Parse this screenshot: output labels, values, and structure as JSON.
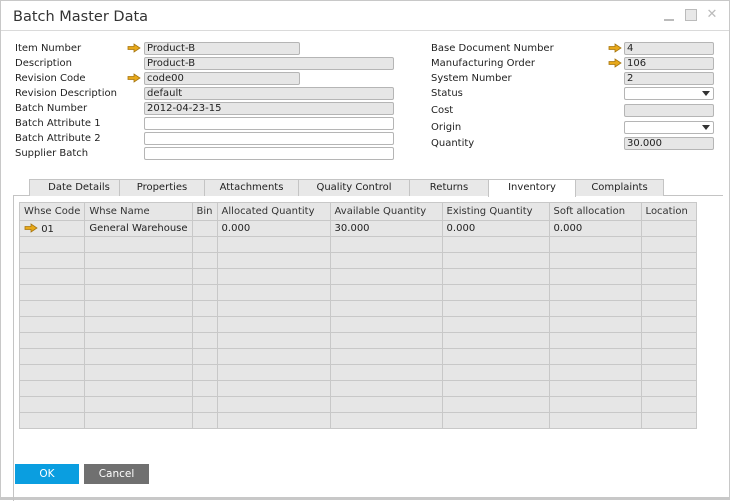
{
  "window": {
    "title": "Batch Master Data",
    "controls": [
      "minimize",
      "maximize",
      "close"
    ]
  },
  "left_fields": [
    {
      "label": "Item Number",
      "value": "Product-B",
      "link_arrow": true
    },
    {
      "label": "Description",
      "value": "Product-B",
      "link_arrow": false
    },
    {
      "label": "Revision Code",
      "value": "code00",
      "link_arrow": true
    },
    {
      "label": "Revision Description",
      "value": "default",
      "link_arrow": false
    },
    {
      "label": "Batch Number",
      "value": "2012-04-23-15",
      "link_arrow": false
    },
    {
      "label": "Batch Attribute 1",
      "value": "",
      "link_arrow": false
    },
    {
      "label": "Batch Attribute 2",
      "value": "",
      "link_arrow": false
    },
    {
      "label": "Supplier Batch",
      "value": "",
      "link_arrow": false
    }
  ],
  "right_fields": [
    {
      "label": "Base Document Number",
      "value": "4",
      "link_arrow": true
    },
    {
      "label": "Manufacturing Order",
      "value": "106",
      "link_arrow": true
    },
    {
      "label": "System Number",
      "value": "2",
      "link_arrow": false
    },
    {
      "label": "Status",
      "value": "",
      "type": "dropdown"
    },
    {
      "label": "Cost",
      "value": ""
    },
    {
      "label": "Origin",
      "value": "",
      "type": "dropdown"
    },
    {
      "label": "Quantity",
      "value": "30.000"
    }
  ],
  "tabs": [
    {
      "label": "Date Details",
      "active": false
    },
    {
      "label": "Properties",
      "active": false
    },
    {
      "label": "Attachments",
      "active": false
    },
    {
      "label": "Quality Control",
      "active": false
    },
    {
      "label": "Returns",
      "active": false
    },
    {
      "label": "Inventory",
      "active": true
    },
    {
      "label": "Complaints",
      "active": false
    }
  ],
  "inventory_table": {
    "columns": [
      "Whse Code",
      "Whse Name",
      "Bin",
      "Allocated Quantity",
      "Available Quantity",
      "Existing Quantity",
      "Soft allocation",
      "Location"
    ],
    "rows": [
      {
        "whse_code": "01",
        "whse_name": "General Warehouse",
        "bin": "",
        "allocated": "0.000",
        "available": "30.000",
        "existing": "0.000",
        "soft_allocation": "0.000",
        "location": "",
        "link_arrow": true
      }
    ],
    "empty_rows": 12
  },
  "buttons": {
    "ok": "OK",
    "cancel": "Cancel"
  },
  "colors": {
    "link_arrow": "#e8a91a",
    "ok_button": "#0a9ee0",
    "cancel_button": "#707070",
    "field_bg": "#e6e6e6"
  }
}
